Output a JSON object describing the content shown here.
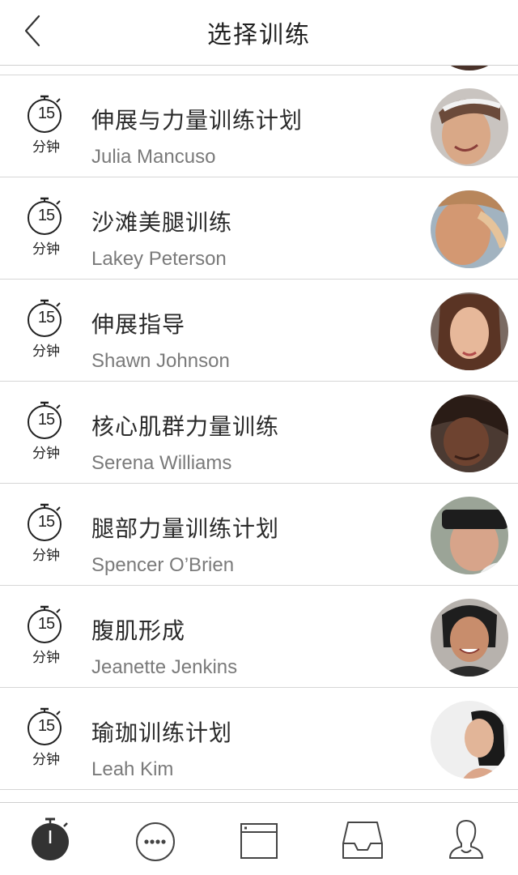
{
  "header": {
    "title": "选择训练",
    "back_icon": "chevron-left-icon"
  },
  "workouts": [
    {
      "duration": "15",
      "unit": "分钟",
      "title": "伸展与力量训练计划",
      "trainer": "Julia Mancuso"
    },
    {
      "duration": "15",
      "unit": "分钟",
      "title": "沙滩美腿训练",
      "trainer": "Lakey Peterson"
    },
    {
      "duration": "15",
      "unit": "分钟",
      "title": "伸展指导",
      "trainer": "Shawn Johnson"
    },
    {
      "duration": "15",
      "unit": "分钟",
      "title": "核心肌群力量训练",
      "trainer": "Serena Williams"
    },
    {
      "duration": "15",
      "unit": "分钟",
      "title": "腿部力量训练计划",
      "trainer": "Spencer O’Brien"
    },
    {
      "duration": "15",
      "unit": "分钟",
      "title": "腹肌形成",
      "trainer": "Jeanette Jenkins"
    },
    {
      "duration": "15",
      "unit": "分钟",
      "title": "瑜珈训练计划",
      "trainer": "Leah Kim"
    }
  ],
  "tabbar": {
    "items": [
      {
        "icon": "stopwatch-icon",
        "active": true
      },
      {
        "icon": "more-dots-icon",
        "active": false
      },
      {
        "icon": "window-icon",
        "active": false
      },
      {
        "icon": "inbox-tray-icon",
        "active": false
      },
      {
        "icon": "profile-icon",
        "active": false
      }
    ]
  },
  "colors": {
    "text": "#2b2b2b",
    "subtext": "#7a7a7a",
    "divider": "#d6d6d6",
    "icon": "#3a3a3a",
    "active_icon": "#333333"
  }
}
